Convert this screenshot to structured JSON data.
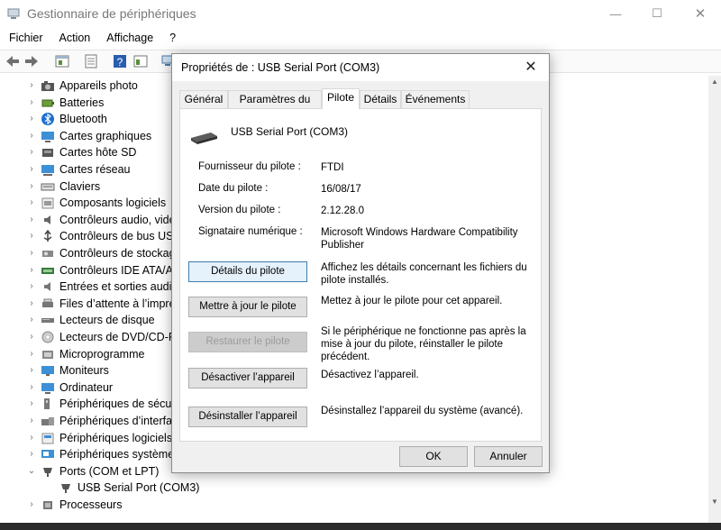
{
  "main": {
    "title": "Gestionnaire de périphériques",
    "window_controls": {
      "minimize": "—",
      "maximize": "☐",
      "close": "✕"
    },
    "menu": [
      "Fichier",
      "Action",
      "Affichage",
      "?"
    ],
    "tree": [
      {
        "label": "Appareils photo",
        "icon": "camera-icon",
        "chevron": "›"
      },
      {
        "label": "Batteries",
        "icon": "battery-icon",
        "chevron": "›"
      },
      {
        "label": "Bluetooth",
        "icon": "bluetooth-icon",
        "chevron": "›"
      },
      {
        "label": "Cartes graphiques",
        "icon": "display-adapter-icon",
        "chevron": "›"
      },
      {
        "label": "Cartes hôte SD",
        "icon": "sd-host-icon",
        "chevron": "›"
      },
      {
        "label": "Cartes réseau",
        "icon": "network-adapter-icon",
        "chevron": "›"
      },
      {
        "label": "Claviers",
        "icon": "keyboard-icon",
        "chevron": "›"
      },
      {
        "label": "Composants logiciels",
        "icon": "software-component-icon",
        "chevron": "›"
      },
      {
        "label": "Contrôleurs audio, vidé",
        "icon": "audio-controller-icon",
        "chevron": "›"
      },
      {
        "label": "Contrôleurs de bus USE",
        "icon": "usb-controller-icon",
        "chevron": "›"
      },
      {
        "label": "Contrôleurs de stockag",
        "icon": "storage-controller-icon",
        "chevron": "›"
      },
      {
        "label": "Contrôleurs IDE ATA/ATA",
        "icon": "ide-controller-icon",
        "chevron": "›"
      },
      {
        "label": "Entrées et sorties audio",
        "icon": "audio-io-icon",
        "chevron": "›"
      },
      {
        "label": "Files d’attente à l’impre",
        "icon": "print-queue-icon",
        "chevron": "›"
      },
      {
        "label": "Lecteurs de disque",
        "icon": "disk-drive-icon",
        "chevron": "›"
      },
      {
        "label": "Lecteurs de DVD/CD-RO",
        "icon": "dvd-drive-icon",
        "chevron": "›"
      },
      {
        "label": "Microprogramme",
        "icon": "firmware-icon",
        "chevron": "›"
      },
      {
        "label": "Moniteurs",
        "icon": "monitor-icon",
        "chevron": "›"
      },
      {
        "label": "Ordinateur",
        "icon": "computer-icon",
        "chevron": "›"
      },
      {
        "label": "Périphériques de sécuri",
        "icon": "security-device-icon",
        "chevron": "›"
      },
      {
        "label": "Périphériques d’interfac",
        "icon": "hid-icon",
        "chevron": "›"
      },
      {
        "label": "Périphériques logiciels",
        "icon": "software-device-icon",
        "chevron": "›"
      },
      {
        "label": "Périphériques système",
        "icon": "system-device-icon",
        "chevron": "›"
      },
      {
        "label": "Ports (COM et LPT)",
        "icon": "port-icon",
        "chevron": "⌄"
      },
      {
        "label": "USB Serial Port (COM3)",
        "icon": "port-icon",
        "chevron": "",
        "child": true
      },
      {
        "label": "Processeurs",
        "icon": "processor-icon",
        "chevron": "›"
      }
    ]
  },
  "dialog": {
    "title": "Propriétés de : USB Serial Port (COM3)",
    "close_glyph": "✕",
    "tabs": [
      "Général",
      "Paramètres du port",
      "Pilote",
      "Détails",
      "Événements"
    ],
    "active_tab": "Pilote",
    "device_name": "USB Serial Port (COM3)",
    "info": [
      {
        "label": "Fournisseur du pilote :",
        "value": "FTDI"
      },
      {
        "label": "Date du pilote :",
        "value": "16/08/17"
      },
      {
        "label": "Version du pilote :",
        "value": "2.12.28.0"
      },
      {
        "label": "Signataire numérique :",
        "value": "Microsoft Windows Hardware Compatibility Publisher"
      }
    ],
    "actions": [
      {
        "label": "Détails du pilote",
        "desc": "Affichez les détails concernant les fichiers du pilote installés."
      },
      {
        "label": "Mettre à jour le pilote",
        "desc": "Mettez à jour le pilote pour cet appareil."
      },
      {
        "label": "Restaurer le pilote",
        "desc": "Si le périphérique ne fonctionne pas après la mise à jour du pilote, réinstaller le pilote précédent."
      },
      {
        "label": "Désactiver l’appareil",
        "desc": "Désactivez l’appareil."
      },
      {
        "label": "Désinstaller l’appareil",
        "desc": "Désinstallez l’appareil du système (avancé)."
      }
    ],
    "ok_label": "OK",
    "cancel_label": "Annuler"
  }
}
